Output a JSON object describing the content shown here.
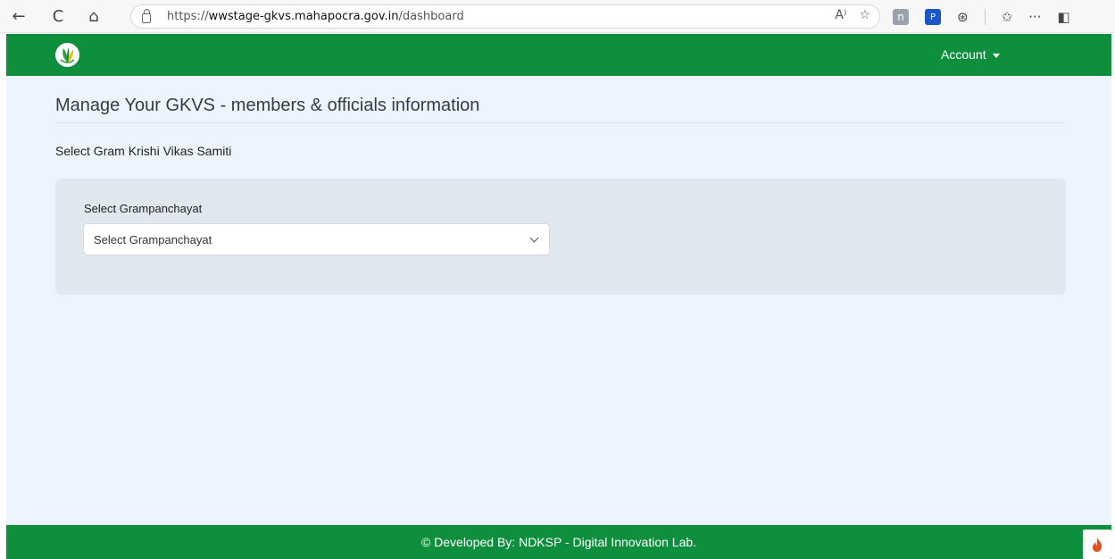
{
  "browser": {
    "back_icon": "←",
    "reload_icon": "C",
    "home_icon": "⌂",
    "url_prefix": "https://",
    "url_host": "wwstage-gkvs.mahapocra.gov.in",
    "url_path": "/dashboard",
    "read_aloud_icon": "A⁾",
    "favorite_icon": "☆",
    "ext_n_label": "n",
    "ext_blue_label": "P",
    "extensions_icon": "⊛",
    "favorites_icon": "✩",
    "more_icon": "···",
    "sidebar_icon": "◧"
  },
  "header": {
    "account_label": "Account"
  },
  "main": {
    "title": "Manage Your GKVS - members & officials information",
    "subtitle": "Select Gram Krishi Vikas Samiti",
    "select_label": "Select Grampanchayat",
    "select_value": "Select Grampanchayat"
  },
  "footer": {
    "text": "© Developed By: NDKSP - Digital Innovation Lab."
  },
  "colors": {
    "brand_green": "#0e8f3e",
    "page_bg": "#eef4fd",
    "panel_bg": "#e1e7ef"
  }
}
